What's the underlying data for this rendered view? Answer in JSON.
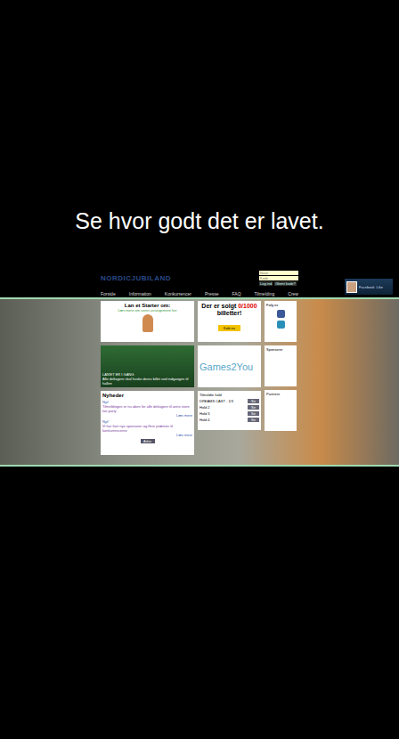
{
  "caption": "Se hvor godt det er lavet.",
  "site": {
    "logo": "NORDICJUBILAND",
    "login": {
      "user_placeholder": "Navn",
      "pass_placeholder": "Kode",
      "buttons": [
        "Log ind",
        "Glemt kode?"
      ]
    },
    "nav": [
      "Forside",
      "Information",
      "Konkurrencer",
      "Presse",
      "FAQ",
      "Tilmelding",
      "Crew"
    ],
    "facebook_widget": {
      "name": "Facebook",
      "action": "Like"
    },
    "intro": {
      "title": "Lan et Starter om:",
      "text": "Læs mere om vores arrangement her"
    },
    "banner": {
      "title": "LAN'ET ER I GANG",
      "text": "Alle deltagere skal huske deres billet ved indgangen til hallen"
    },
    "news": {
      "title": "Nyheder",
      "items": [
        {
          "heading": "Nyt!",
          "text": "Tilmeldingen er nu åben for alle deltagere til årets store lan-party",
          "link": "Læs mere"
        },
        {
          "heading": "Nyt!",
          "text": "Vi har fået nye sponsorer og flere præmier til konkurrencerne",
          "link": "Læs mere"
        }
      ],
      "button": "Arkiv"
    },
    "tickets": {
      "text": "Der er solgt",
      "sold": "0/1000",
      "suffix": "billetter!",
      "button": "Køb nu"
    },
    "sponsor": "Games2You",
    "teams": {
      "title": "Tilmeldte hold",
      "rows": [
        {
          "label": "DREAMS CAST - 1/3",
          "button": "Se"
        },
        {
          "label": "Hold 2",
          "button": "Se"
        },
        {
          "label": "Hold 3",
          "button": "Se"
        },
        {
          "label": "Hold 4",
          "button": "Se"
        }
      ]
    },
    "social": {
      "title": "Følg os"
    },
    "side_boxes": [
      "Sponsorer",
      "Partnere"
    ]
  }
}
